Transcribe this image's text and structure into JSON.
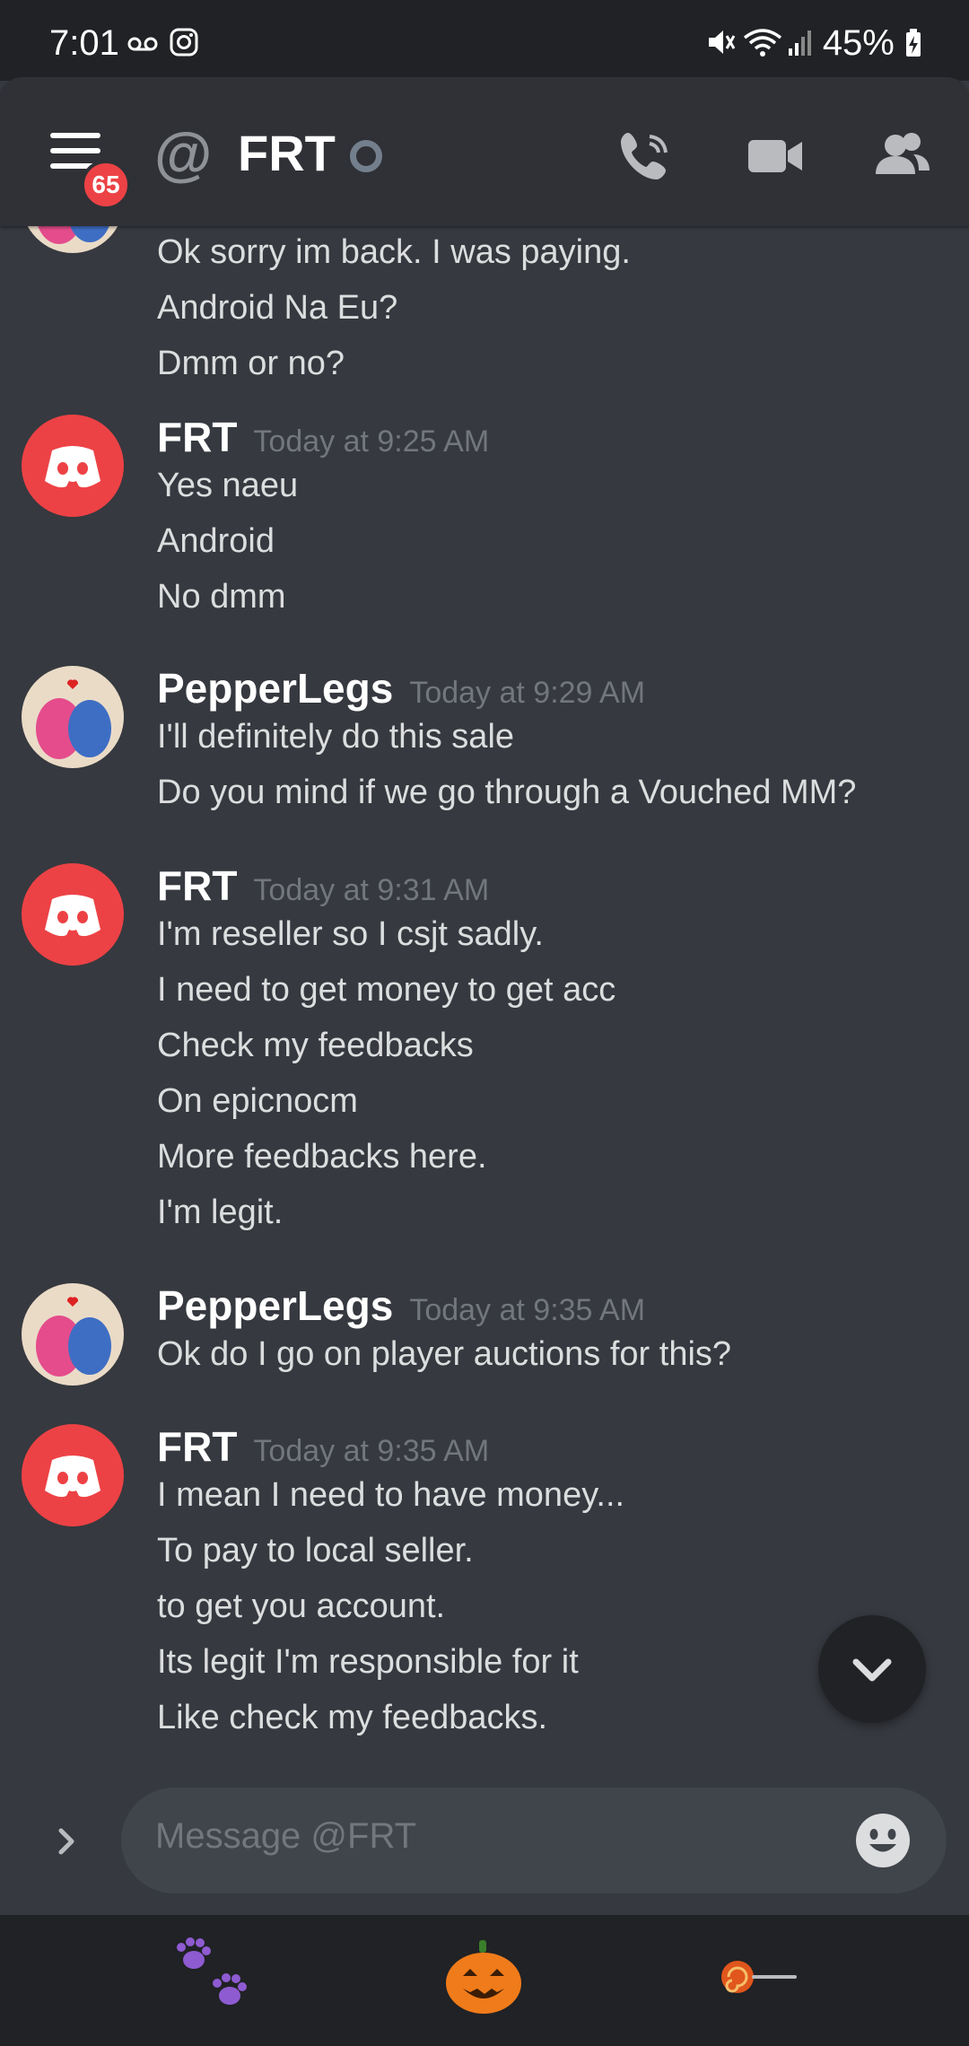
{
  "status_bar": {
    "time": "7:01",
    "battery": "45%",
    "icons": [
      "voicemail-icon",
      "instagram-icon",
      "mute-icon",
      "wifi-icon",
      "signal-icon",
      "battery-charging-icon"
    ]
  },
  "header": {
    "badge_count": "65",
    "channel_name": "FRT",
    "icons": [
      "menu-icon",
      "at-icon",
      "status-offline-icon",
      "voice-call-icon",
      "video-call-icon",
      "members-icon"
    ]
  },
  "messages": [
    {
      "author": "",
      "timestamp": "",
      "avatar": "pepperlegs",
      "lines": [
        "Ok sorry im back. I was paying.",
        "Android Na Eu?",
        "Dmm or no?"
      ]
    },
    {
      "author": "FRT",
      "timestamp": "Today at 9:25 AM",
      "avatar": "discord",
      "lines": [
        "Yes naeu",
        "Android",
        "No dmm"
      ]
    },
    {
      "author": "PepperLegs",
      "timestamp": "Today at 9:29 AM",
      "avatar": "pepperlegs",
      "lines": [
        "I'll definitely do this sale",
        "Do you mind if we go through a Vouched MM?"
      ]
    },
    {
      "author": "FRT",
      "timestamp": "Today at 9:31 AM",
      "avatar": "discord",
      "lines": [
        "I'm reseller so I csjt sadly.",
        "I need to get money to get acc",
        "Check my feedbacks",
        "On epicnocm",
        "More feedbacks here.",
        "I'm legit."
      ]
    },
    {
      "author": "PepperLegs",
      "timestamp": "Today at 9:35 AM",
      "avatar": "pepperlegs",
      "lines": [
        "Ok do I go on player auctions for this?"
      ]
    },
    {
      "author": "FRT",
      "timestamp": "Today at 9:35 AM",
      "avatar": "discord",
      "lines": [
        "I mean I need to have money...",
        "To pay to local seller.",
        "to get you account.",
        "Its legit I'm responsible for it",
        "Like check my feedbacks."
      ]
    }
  ],
  "composer": {
    "placeholder": "Message @FRT"
  },
  "nav": {
    "items": [
      "paw-prints-icon",
      "jack-o-lantern-icon",
      "lollipop-icon"
    ]
  },
  "colors": {
    "background": "#36393f",
    "header": "#2f3136",
    "discord_red": "#ed4245",
    "timestamp": "#72767d"
  }
}
